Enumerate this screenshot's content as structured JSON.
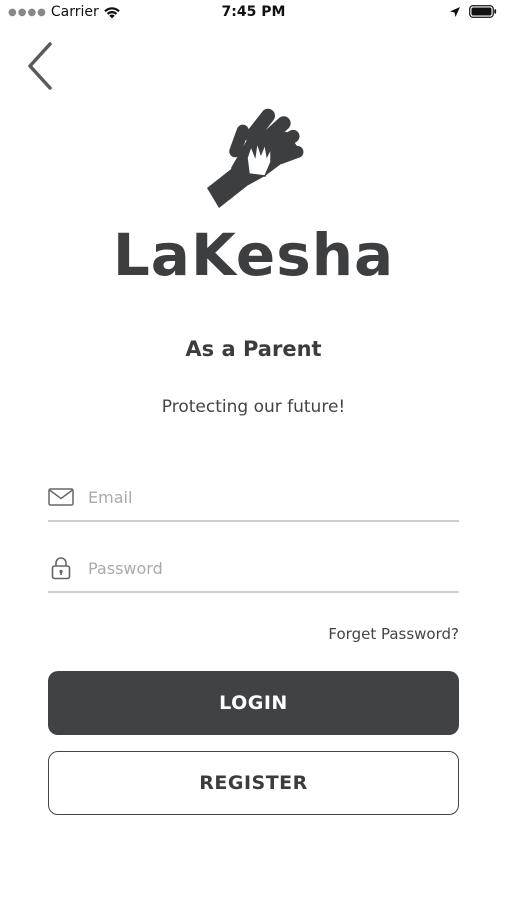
{
  "status_bar": {
    "carrier": "Carrier",
    "time": "7:45 PM"
  },
  "logo": {
    "text": "LaKesha"
  },
  "title": "As a Parent",
  "subtitle": "Protecting our future!",
  "form": {
    "email_placeholder": "Email",
    "email_value": "",
    "password_placeholder": "Password",
    "password_value": ""
  },
  "forgot_password": "Forget Password?",
  "buttons": {
    "login": "LOGIN",
    "register": "REGISTER"
  },
  "colors": {
    "primary": "#414244",
    "background": "#ffffff"
  }
}
